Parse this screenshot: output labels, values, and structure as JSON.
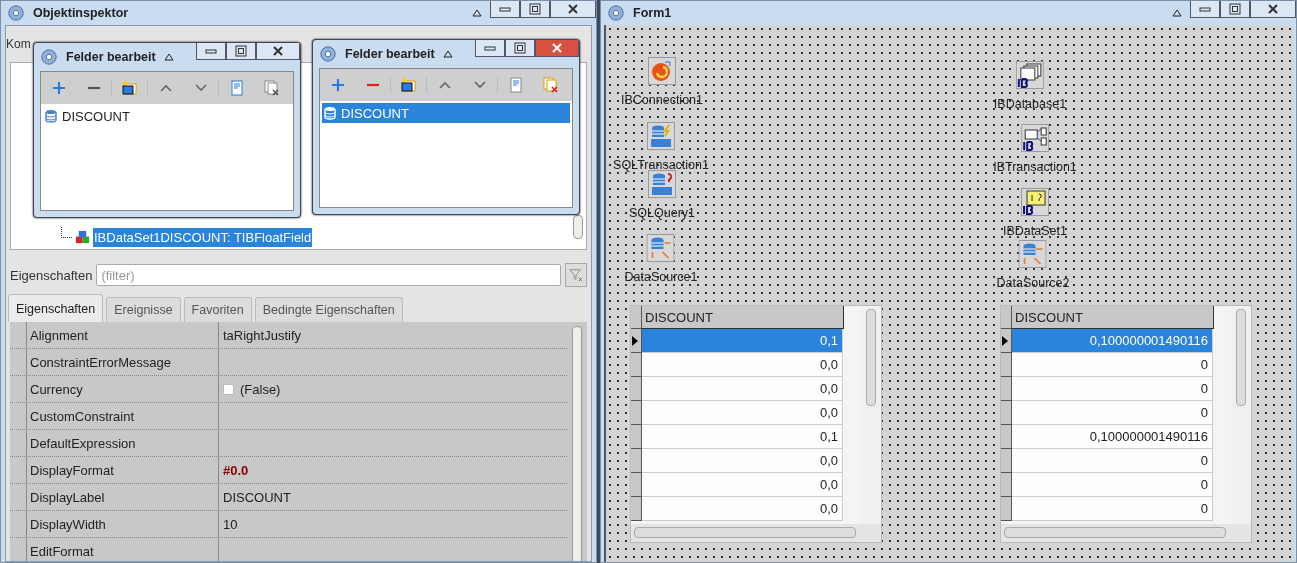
{
  "inspector": {
    "title": "Objektinspektor",
    "component_label": "Kom",
    "tree": [
      {
        "label": "IBDataSet1DISCOUNT: TIBFloatField",
        "selected": true
      }
    ],
    "filter_label": "Eigenschaften",
    "filter": {
      "placeholder": "(filter)"
    },
    "tabs": [
      {
        "label": "Eigenschaften",
        "selected": true
      },
      {
        "label": "Ereignisse",
        "selected": false
      },
      {
        "label": "Favoriten",
        "selected": false
      },
      {
        "label": "Bedingte Eigenschaften",
        "selected": false
      }
    ],
    "properties": [
      {
        "name": "Alignment",
        "kind": "text",
        "value": "taRightJustify"
      },
      {
        "name": "ConstraintErrorMessage",
        "kind": "text"
      },
      {
        "name": "Currency",
        "kind": "checkbox",
        "checked": false,
        "value": "(False)"
      },
      {
        "name": "CustomConstraint",
        "kind": "text"
      },
      {
        "name": "DefaultExpression",
        "kind": "text"
      },
      {
        "name": "DisplayFormat",
        "kind": "modified",
        "value": "#0.0"
      },
      {
        "name": "DisplayLabel",
        "kind": "text",
        "value": "DISCOUNT"
      },
      {
        "name": "DisplayWidth",
        "kind": "text",
        "value": "10"
      },
      {
        "name": "EditFormat",
        "kind": "text"
      }
    ]
  },
  "field_editors": [
    {
      "title": "Felder bearbeit",
      "active": false,
      "fields": [
        {
          "label": "DISCOUNT",
          "selected": false
        }
      ]
    },
    {
      "title": "Felder bearbeit",
      "active": true,
      "fields": [
        {
          "label": "DISCOUNT",
          "selected": true
        }
      ]
    }
  ],
  "form": {
    "title": "Form1",
    "components": [
      {
        "name": "IBConnection1",
        "kind": "connection"
      },
      {
        "name": "SQLTransaction1",
        "kind": "sql-transaction"
      },
      {
        "name": "SQLQuery1",
        "kind": "sql-query"
      },
      {
        "name": "DataSource1",
        "kind": "datasource"
      },
      {
        "name": "IBDatabase1",
        "kind": "ib-database"
      },
      {
        "name": "IBTransaction1",
        "kind": "ib-transaction"
      },
      {
        "name": "IBDataSet1",
        "kind": "ib-dataset"
      },
      {
        "name": "DataSource2",
        "kind": "datasource"
      }
    ],
    "grids": [
      {
        "column": "DISCOUNT",
        "rows": [
          {
            "value": "0,1",
            "selected": true
          },
          {
            "value": "0,0",
            "selected": false
          },
          {
            "value": "0,0",
            "selected": false
          },
          {
            "value": "0,0",
            "selected": false
          },
          {
            "value": "0,1",
            "selected": false
          },
          {
            "value": "0,0",
            "selected": false
          },
          {
            "value": "0,0",
            "selected": false
          },
          {
            "value": "0,0",
            "selected": false
          }
        ]
      },
      {
        "column": "DISCOUNT",
        "rows": [
          {
            "value": "0,100000001490116",
            "selected": true
          },
          {
            "value": "0",
            "selected": false
          },
          {
            "value": "0",
            "selected": false
          },
          {
            "value": "0",
            "selected": false
          },
          {
            "value": "0,100000001490116",
            "selected": false
          },
          {
            "value": "0",
            "selected": false
          },
          {
            "value": "0",
            "selected": false
          },
          {
            "value": "0",
            "selected": false
          }
        ]
      }
    ]
  }
}
